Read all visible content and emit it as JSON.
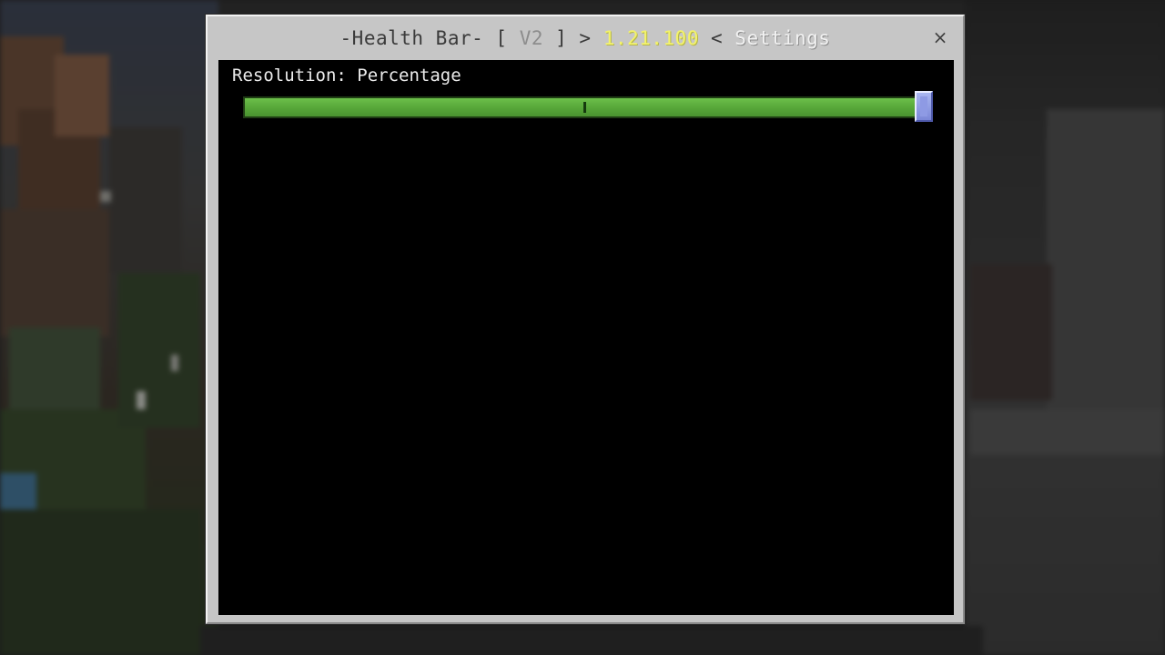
{
  "dialog": {
    "title_parts": {
      "prefix": "-Health Bar- [ ",
      "version": "V2",
      "suffix_arrow": " ] > ",
      "game_version": "1.21.100",
      "back_arrow": " < ",
      "page": "Settings"
    },
    "close_glyph": "×",
    "close_icon": "close-icon"
  },
  "setting": {
    "label": "Resolution: Percentage",
    "slider_value_fraction": 1.0,
    "slider_tick_fraction": 0.5
  },
  "colors": {
    "slider_green": "#56a33a",
    "thumb_blue": "#8e9ae4",
    "version_yellow": "#f3f36a"
  }
}
